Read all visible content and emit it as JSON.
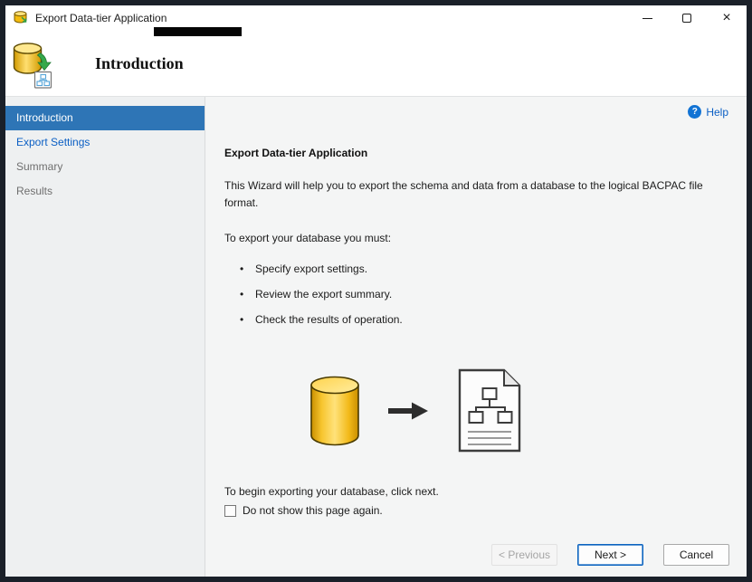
{
  "window": {
    "title": "Export Data-tier Application",
    "controls": {
      "minimize_icon": "minimize",
      "maximize_icon": "maximize",
      "close_glyph": "×"
    }
  },
  "header": {
    "title": "Introduction"
  },
  "sidebar": {
    "items": [
      {
        "label": "Introduction",
        "state": "selected"
      },
      {
        "label": "Export Settings",
        "state": "enabled-link"
      },
      {
        "label": "Summary",
        "state": "disabled"
      },
      {
        "label": "Results",
        "state": "disabled"
      }
    ]
  },
  "content": {
    "help_label": "Help",
    "help_icon_glyph": "?",
    "heading": "Export Data-tier Application",
    "intro_text": "This Wizard will help you to export the schema and data from a database to the logical BACPAC file format.",
    "requirements_label": "To export your database you must:",
    "bullets": [
      "Specify export settings.",
      "Review the export summary.",
      "Check the results of operation."
    ],
    "illustration": {
      "from_icon": "database-cylinder",
      "arrow_icon": "right-arrow",
      "to_icon": "bacpac-document-with-schema"
    },
    "footer_text": "To begin exporting your database, click next.",
    "checkbox": {
      "label": "Do not show this page again.",
      "checked": false
    }
  },
  "buttons": {
    "previous": "< Previous",
    "next": "Next >",
    "cancel": "Cancel"
  },
  "colors": {
    "selected_step_bg": "#2e75b6",
    "link_blue": "#0b5fc4",
    "next_button_border": "#0c64c0",
    "database_yellow": "#f2b918",
    "arrow_green": "#35a84b"
  }
}
